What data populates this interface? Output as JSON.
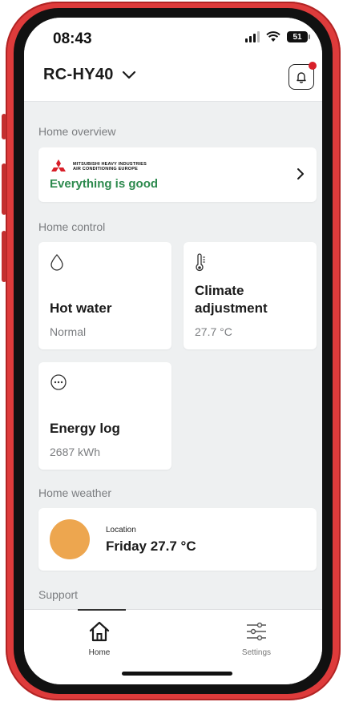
{
  "status_bar": {
    "time": "08:43",
    "battery": "51"
  },
  "header": {
    "device_name": "RC-HY40"
  },
  "overview": {
    "section_title": "Home overview",
    "brand_line1": "MITSUBISHI HEAVY INDUSTRIES",
    "brand_line2": "AIR CONDITIONING EUROPE",
    "status_text": "Everything is good"
  },
  "control": {
    "section_title": "Home control",
    "hot_water": {
      "title": "Hot water",
      "value": "Normal"
    },
    "climate": {
      "title_line1": "Climate",
      "title_line2": "adjustment",
      "value": "27.7 °C"
    },
    "energy": {
      "title": "Energy log",
      "value": "2687 kWh"
    }
  },
  "weather": {
    "section_title": "Home weather",
    "location_label": "Location",
    "summary": "Friday 27.7 °C"
  },
  "support": {
    "section_title": "Support"
  },
  "tabs": [
    {
      "label": "Home",
      "icon": "home-icon",
      "active": true
    },
    {
      "label": "Settings",
      "icon": "sliders-icon",
      "active": false
    }
  ],
  "colors": {
    "accent_green": "#2d8a4e",
    "notification_red": "#d8202a",
    "sun": "#eda64f",
    "frame": "#de3b3b"
  }
}
